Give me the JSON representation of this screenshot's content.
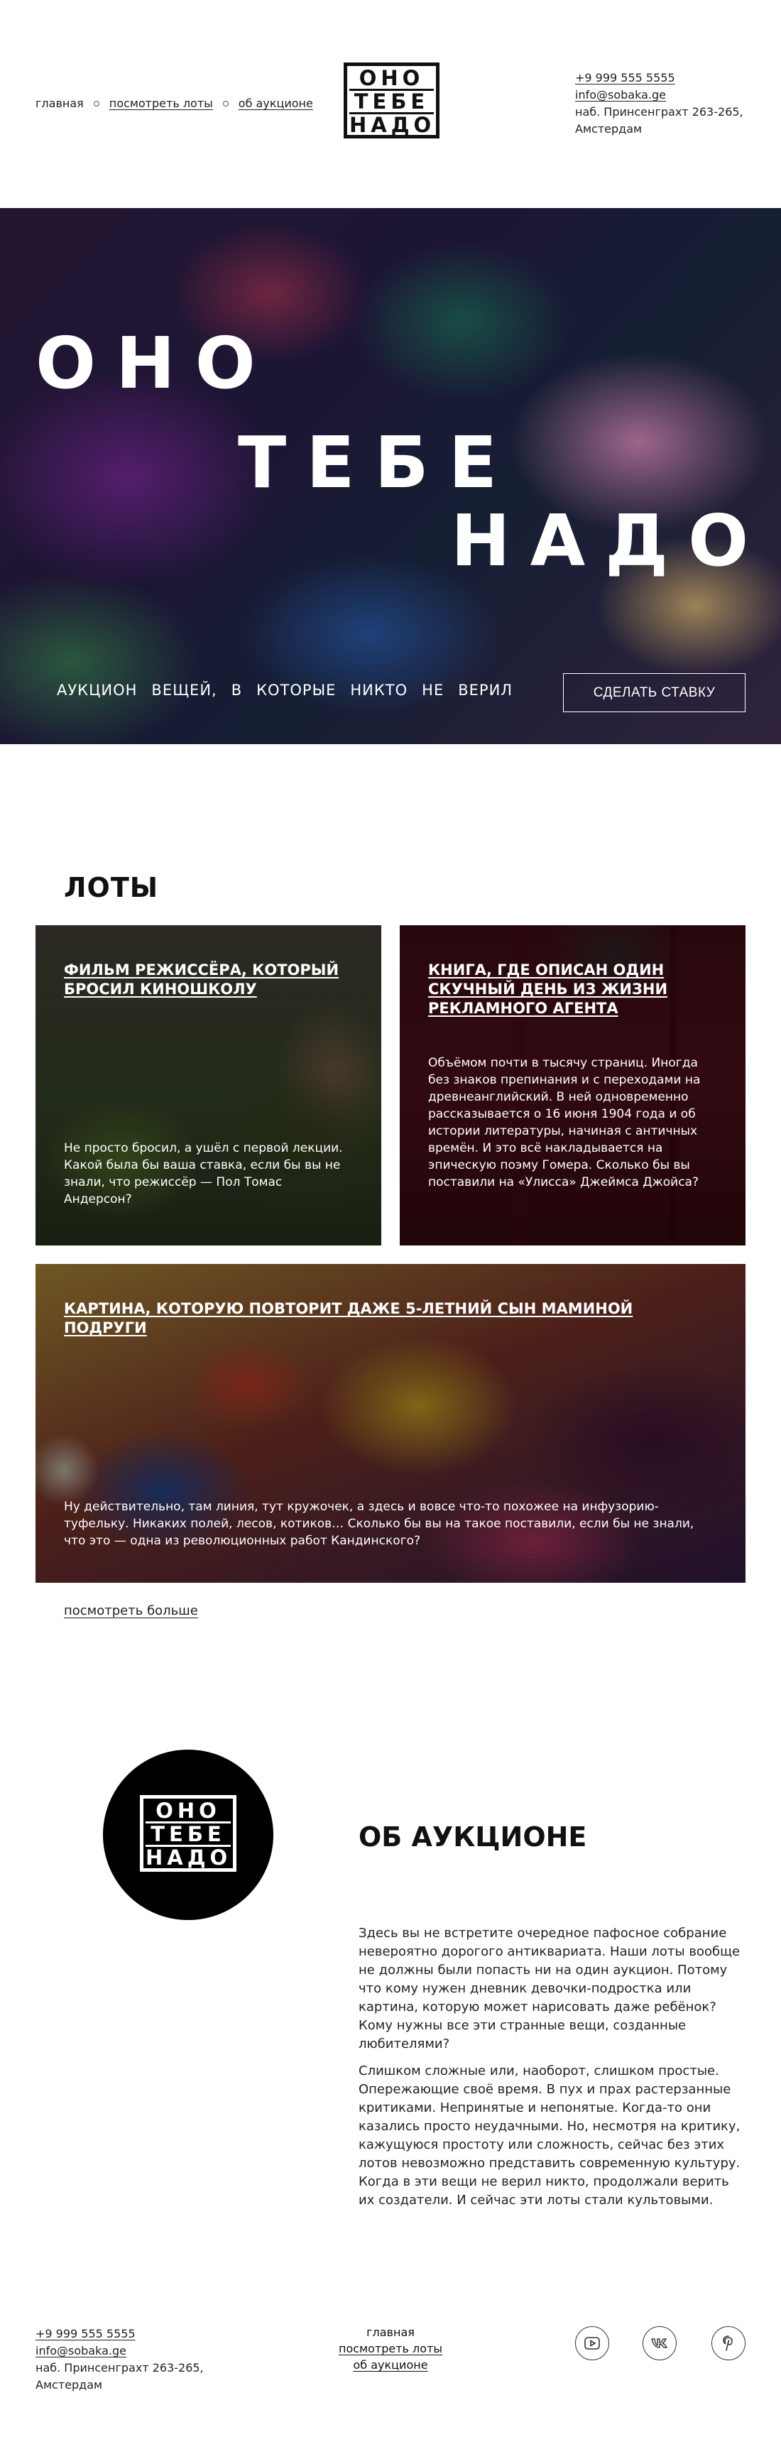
{
  "header": {
    "nav": [
      "главная",
      "посмотреть лоты",
      "об аукционе"
    ],
    "logo_lines": [
      "ОНО",
      "ТЕБЕ",
      "НАДО"
    ],
    "phone": "+9 999 555 5555",
    "email": "info@sobaka.ge",
    "address_line1": "наб. Принсенграхт 263-265,",
    "address_line2": "Амстердам"
  },
  "hero": {
    "word1": "ОНО",
    "word2": "ТЕБЕ",
    "word3": "НАДО",
    "tagline": [
      "АУКЦИОН",
      "ВЕЩЕЙ,",
      "В",
      "КОТОРЫЕ",
      "НИКТО",
      "НЕ",
      "ВЕРИЛ"
    ],
    "bid_button": "СДЕЛАТЬ СТАВКУ"
  },
  "lots": {
    "title": "ЛОТЫ",
    "items": [
      {
        "title": "ФИЛЬМ РЕЖИССЁРА, КОТОРЫЙ БРОСИЛ КИНОШКОЛУ",
        "text": "Не просто бросил, а ушёл с первой лекции. Какой была бы ваша ставка, если бы вы не знали, что режиссёр — Пол Томас Андерсон?"
      },
      {
        "title": "КНИГА, ГДЕ ОПИСАН ОДИН СКУЧНЫЙ ДЕНЬ ИЗ ЖИЗНИ РЕКЛАМНОГО АГЕНТА",
        "text": "Объёмом почти в тысячу страниц. Иногда без знаков препинания и с переходами на древнеанглийский. В ней одновременно рассказывается о 16 июня 1904 года и об истории литературы, начиная с античных времён. И это всё накладывается на эпическую поэму Гомера. Сколько бы вы поставили на «Улисса» Джеймса Джойса?"
      },
      {
        "title": "КАРТИНА, КОТОРУЮ ПОВТОРИТ ДАЖЕ 5-ЛЕТНИЙ СЫН МАМИНОЙ ПОДРУГИ",
        "text": "Ну действительно, там линия, тут кружочек, а здесь и вовсе что-то похожее на инфузорию-туфельку. Никаких полей, лесов, котиков… Сколько бы вы на такое поставили, если бы не знали, что это — одна из революционных работ Кандинского?"
      }
    ],
    "more_link": "посмотреть больше"
  },
  "about": {
    "title": "ОБ АУКЦИОНЕ",
    "p1": "Здесь вы не встретите очередное пафосное собрание невероятно дорогого антиквариата. Наши лоты вообще не должны были попасть ни на один аукцион. Потому что кому нужен дневник девочки-подростка или картина, которую может нарисовать даже ребёнок? Кому нужны все эти странные вещи, созданные любителями?",
    "p2": "Слишком сложные или, наоборот, слишком простые. Опережающие своё время. В пух и прах растерзанные критиками. Непринятые и непонятые. Когда-то они казались просто неудачными. Но, несмотря на критику, кажущуюся простоту или сложность, сейчас без этих лотов невозможно представить современную культуру. Когда в эти вещи не верил никто, продолжали верить их создатели. И сейчас эти лоты стали культовыми."
  },
  "footer": {
    "phone": "+9 999 555 5555",
    "email": "info@sobaka.ge",
    "address_line1": "наб. Принсенграхт 263-265,",
    "address_line2": "Амстердам",
    "nav": [
      "главная",
      "посмотреть лоты",
      "об аукционе"
    ],
    "social": [
      "youtube-icon",
      "vk-icon",
      "pinterest-icon"
    ]
  }
}
